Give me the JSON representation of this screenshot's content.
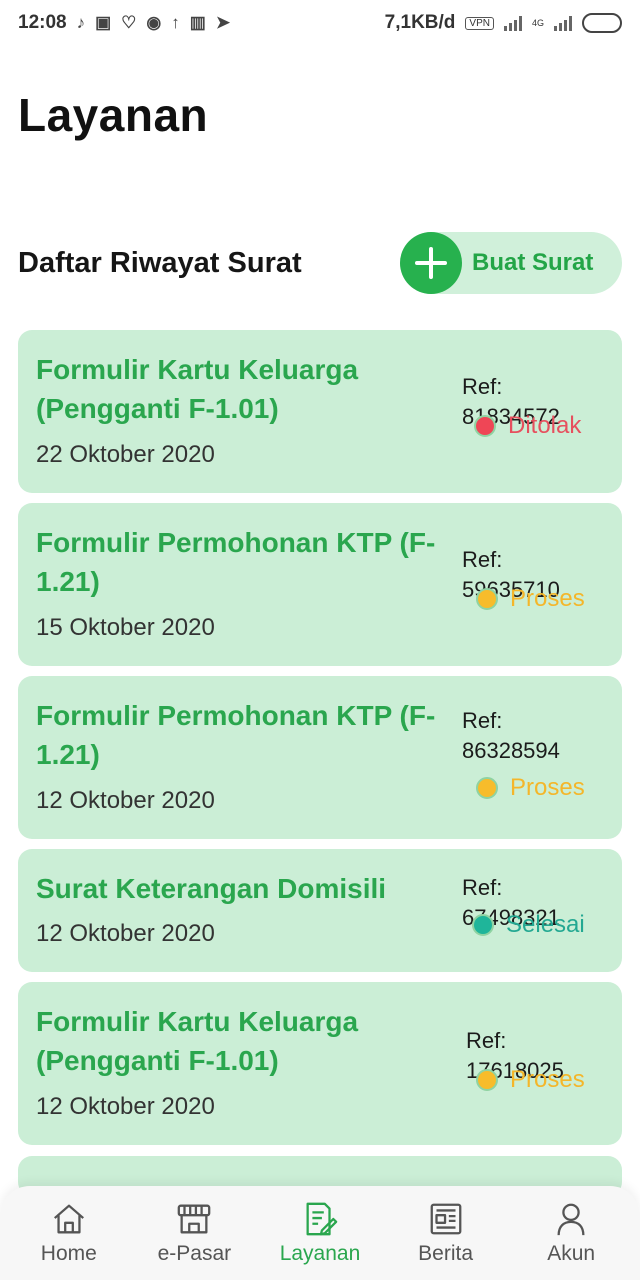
{
  "status_bar": {
    "time": "12:08",
    "network_speed": "7,1KB/d",
    "vpn": "VPN",
    "network_type": "4G"
  },
  "page": {
    "title": "Layanan"
  },
  "section": {
    "title": "Daftar Riwayat Surat",
    "create_button_label": "Buat Surat"
  },
  "letters": [
    {
      "title": "Formulir Kartu Keluarga (Pengganti F-1.01)",
      "date": "22 Oktober 2020",
      "ref": "Ref: 81834572",
      "status": "Ditolak",
      "status_color": "#e6505e"
    },
    {
      "title": "Formulir Permohonan KTP (F-1.21)",
      "date": "15 Oktober 2020",
      "ref": "Ref: 59635710",
      "status": "Proses",
      "status_color": "#f4b62a"
    },
    {
      "title": "Formulir Permohonan KTP (F-1.21)",
      "date": "12 Oktober 2020",
      "ref": "Ref: 86328594",
      "status": "Proses",
      "status_color": "#f4b62a"
    },
    {
      "title": "Surat Keterangan Domisili",
      "date": "12 Oktober 2020",
      "ref": "Ref: 67498321",
      "status": "Selesai",
      "status_color": "#23a892"
    },
    {
      "title": "Formulir Kartu Keluarga (Pengganti F-1.01)",
      "date": "12 Oktober 2020",
      "ref": "Ref: 17618025",
      "status": "Proses",
      "status_color": "#f4b62a"
    }
  ],
  "bottom_nav": [
    {
      "label": "Home",
      "icon": "home-icon",
      "active": false
    },
    {
      "label": "e-Pasar",
      "icon": "store-icon",
      "active": false
    },
    {
      "label": "Layanan",
      "icon": "document-edit-icon",
      "active": true
    },
    {
      "label": "Berita",
      "icon": "newspaper-icon",
      "active": false
    },
    {
      "label": "Akun",
      "icon": "user-icon",
      "active": false
    }
  ],
  "colors": {
    "accent": "#27b14e",
    "card_bg": "#cbeed6",
    "status_rejected": "#e6505e",
    "status_process": "#f4b62a",
    "status_done": "#23a892"
  }
}
